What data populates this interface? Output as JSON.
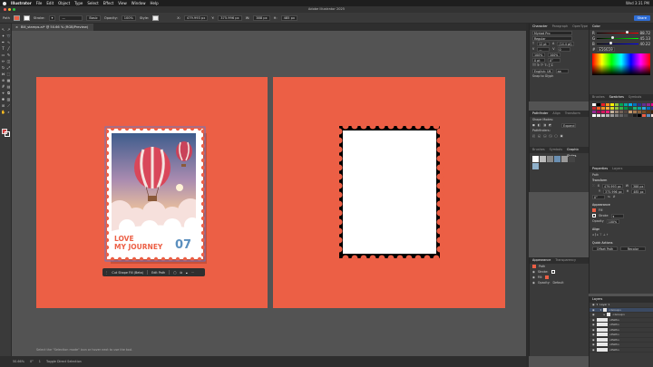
{
  "menubar": {
    "app": "Illustrator",
    "items": [
      "File",
      "Edit",
      "Object",
      "Type",
      "Select",
      "Effect",
      "View",
      "Window",
      "Help"
    ],
    "right": "Wed 3:31 PM"
  },
  "window": {
    "title": "Adobe Illustrator 2025"
  },
  "control": {
    "path_label": "Path",
    "stroke_label": "Stroke:",
    "basic_label": "Basic",
    "opacity_label": "Opacity:",
    "opacity_value": "100%",
    "style_label": "Style:",
    "x_value": "479.993 px",
    "y_value": "375.996 px",
    "w_value": "388 px",
    "h_value": "485 px",
    "share_label": "Share"
  },
  "tab": {
    "label": "Bill_stamps.ai* @ 50.66 % (RGB/Preview)"
  },
  "stamp": {
    "line1": "LOVE",
    "line2": "MY JOURNEY",
    "number": "07",
    "accent": "#ec5f45",
    "number_color": "#5b8fbe"
  },
  "artboard_color": "#ec5f45",
  "taskbar": {
    "items": [
      "Cut Shape Fill (Beta)",
      "Edit Path"
    ]
  },
  "status": {
    "zoom": "50.66%",
    "angle": "0°",
    "artboard": "1",
    "mode": "Toggle Direct Selection",
    "hint": "Select the \"Selection mode\" icon or hover next to use the tool."
  },
  "panels": {
    "character": {
      "tabs": [
        "Character",
        "Paragraph",
        "OpenType"
      ],
      "font": "Myriad Pro",
      "style": "Regular",
      "size": "12 pt",
      "leading": "(14.4 pt)",
      "tracking": "0",
      "lang": "English: UK",
      "snap": "Snap to Glyph"
    },
    "pathfinder": {
      "tabs": [
        "Pathfinder",
        "Align",
        "Transform"
      ],
      "shape_modes": "Shape Modes:",
      "pathfinders": "Pathfinders:"
    },
    "graphic_styles": {
      "tabs": [
        "Brushes",
        "Symbols",
        "Graphic Styles"
      ]
    },
    "appearance": {
      "tabs": [
        "Appearance",
        "Transparency"
      ],
      "path": "Path",
      "stroke": "Stroke:",
      "fill": "Fill:",
      "opacity": "Opacity:",
      "opacity_value": "Default"
    },
    "color": {
      "title": "Color",
      "r": "88.72",
      "g": "45.13",
      "b": "40.22",
      "hex": "E56659"
    },
    "swatches": {
      "tabs": [
        "Brushes",
        "Swatches",
        "Symbols"
      ]
    },
    "properties": {
      "tabs": [
        "Properties",
        "Layers"
      ],
      "path": "Path",
      "transform": "Transform",
      "x": "479.993 px",
      "y": "375.996 px",
      "w": "388 px",
      "h": "485 px",
      "appearance": "Appearance",
      "fill": "Fill",
      "stroke": "Stroke",
      "opacity": "Opacity",
      "opacity_value": "100%",
      "align": "Align",
      "quick_actions": "Quick Actions",
      "offset_path": "Offset Path",
      "recolor": "Recolor"
    },
    "layers": {
      "title": "Layers",
      "layer_name": "Layer 1",
      "sublayer": "<Group>",
      "rows": [
        "<Group>",
        "<Group>",
        "<Path>",
        "<Path>",
        "<Path>",
        "<Path>",
        "<Path>",
        "<Path>",
        "<Path>"
      ]
    }
  }
}
